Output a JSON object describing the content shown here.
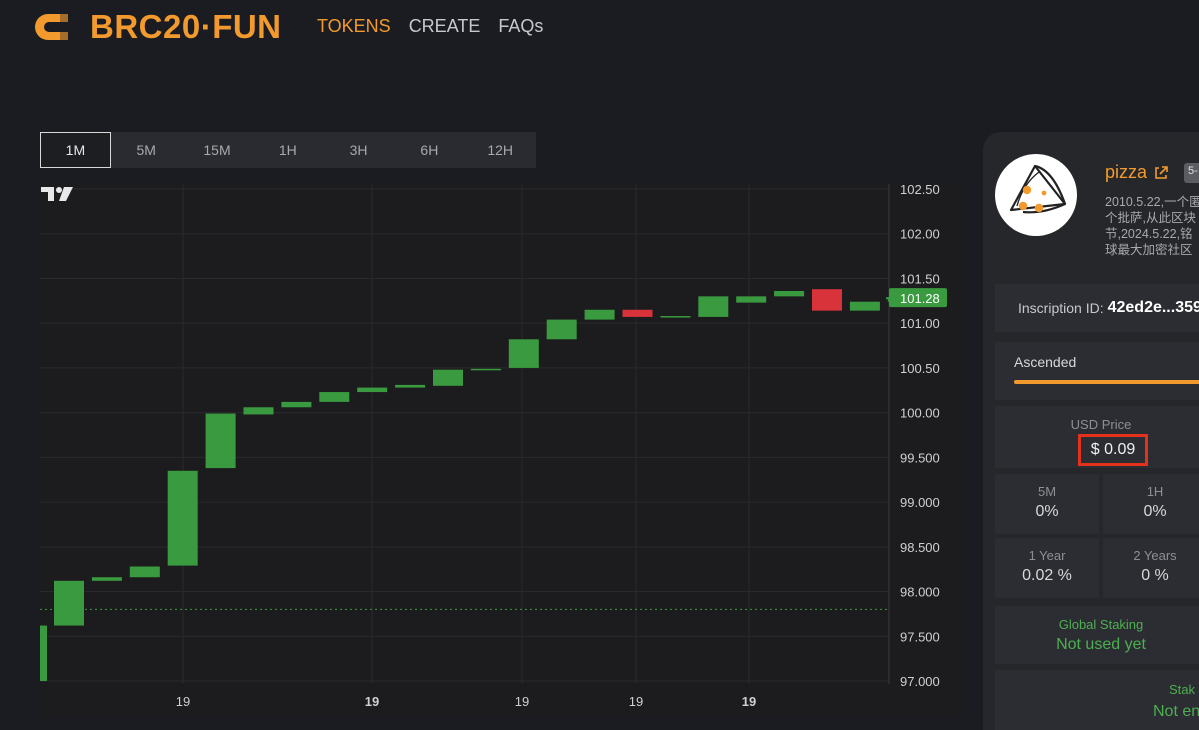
{
  "header": {
    "logo_text": "BRC20·FUN",
    "nav": [
      {
        "label": "TOKENS",
        "active": true
      },
      {
        "label": "CREATE",
        "active": false
      },
      {
        "label": "FAQs",
        "active": false
      }
    ]
  },
  "timeframes": [
    {
      "label": "1M",
      "active": true
    },
    {
      "label": "5M",
      "active": false
    },
    {
      "label": "15M",
      "active": false
    },
    {
      "label": "1H",
      "active": false
    },
    {
      "label": "3H",
      "active": false
    },
    {
      "label": "6H",
      "active": false
    },
    {
      "label": "12H",
      "active": false
    }
  ],
  "chart_data": {
    "type": "candlestick",
    "y_ticks": [
      "102.50",
      "102.00",
      "101.50",
      "101.00",
      "100.50",
      "100.00",
      "99.500",
      "99.000",
      "98.500",
      "98.000",
      "97.500",
      "97.000"
    ],
    "ylim": [
      97.0,
      102.5
    ],
    "x_ticks": [
      {
        "label": "19",
        "bold": false
      },
      {
        "label": "19",
        "bold": true
      },
      {
        "label": "19",
        "bold": false
      },
      {
        "label": "19",
        "bold": false
      },
      {
        "label": "19",
        "bold": true
      }
    ],
    "last_price_label": "101.28",
    "reference_line_value": 97.8,
    "candles": [
      {
        "open": 97.0,
        "close": 97.62,
        "up": true
      },
      {
        "open": 97.62,
        "close": 98.12,
        "up": true
      },
      {
        "open": 98.12,
        "close": 98.16,
        "up": true
      },
      {
        "open": 98.16,
        "close": 98.28,
        "up": true
      },
      {
        "open": 98.29,
        "close": 99.35,
        "up": true
      },
      {
        "open": 99.38,
        "close": 99.99,
        "up": true
      },
      {
        "open": 99.98,
        "close": 100.06,
        "up": true
      },
      {
        "open": 100.06,
        "close": 100.12,
        "up": true
      },
      {
        "open": 100.12,
        "close": 100.23,
        "up": true
      },
      {
        "open": 100.23,
        "close": 100.28,
        "up": true
      },
      {
        "open": 100.28,
        "close": 100.31,
        "up": true
      },
      {
        "open": 100.3,
        "close": 100.48,
        "up": true
      },
      {
        "open": 100.48,
        "close": 100.49,
        "up": true
      },
      {
        "open": 100.5,
        "close": 100.82,
        "up": true
      },
      {
        "open": 100.82,
        "close": 101.04,
        "up": true
      },
      {
        "open": 101.04,
        "close": 101.15,
        "up": true
      },
      {
        "open": 101.15,
        "close": 101.07,
        "up": false
      },
      {
        "open": 101.07,
        "close": 101.08,
        "up": true
      },
      {
        "open": 101.07,
        "close": 101.3,
        "up": true
      },
      {
        "open": 101.23,
        "close": 101.3,
        "up": true
      },
      {
        "open": 101.3,
        "close": 101.36,
        "up": true
      },
      {
        "open": 101.38,
        "close": 101.14,
        "up": false
      },
      {
        "open": 101.14,
        "close": 101.24,
        "up": true
      },
      {
        "open": 101.24,
        "close": 101.29,
        "up": true
      }
    ],
    "colors": {
      "up": "#3a9a3f",
      "down": "#d8323a",
      "grid": "#2a2a2e",
      "axis_text": "#d0d0d0"
    }
  },
  "token": {
    "name": "pizza",
    "badge": "5-",
    "description_lines": [
      "2010.5.22,一个匿",
      "个批萨,从此区块",
      "节,2024.5.22,铭",
      "球最大加密社区"
    ],
    "inscription_label": "Inscription ID:",
    "inscription_id": "42ed2e...359",
    "ascended_label": "Ascended",
    "usd_price_label": "USD Price",
    "usd_price": "$ 0.09",
    "stats": [
      {
        "k": "5M",
        "v": "0%"
      },
      {
        "k": "1H",
        "v": "0%"
      },
      {
        "k": "1 Year",
        "v": "0.02 %"
      },
      {
        "k": "2 Years",
        "v": "0 %"
      }
    ],
    "global_staking_label": "Global Staking",
    "global_staking_value": "Not used yet",
    "staking_label": "Stak",
    "staking_value": "Not en"
  }
}
